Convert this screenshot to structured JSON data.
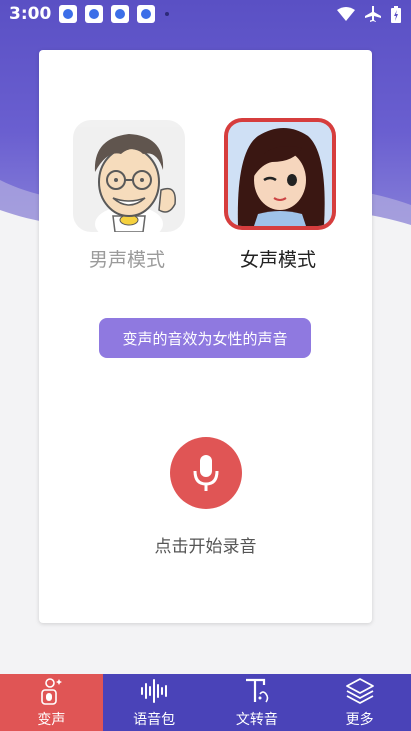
{
  "status_bar": {
    "time": "3:00",
    "app_icons": [
      "baidu-icon",
      "baidu-icon",
      "baidu-icon",
      "baidu-icon"
    ],
    "right_icons": [
      "wifi-icon",
      "airplane-icon",
      "battery-icon"
    ]
  },
  "card": {
    "male_label": "男声模式",
    "female_label": "女声模式",
    "hint": "变声的音效为女性的声音",
    "record_label": "点击开始录音"
  },
  "bottom_nav": {
    "items": [
      {
        "label": "变声",
        "icon": "voice-change-icon"
      },
      {
        "label": "语音包",
        "icon": "waveform-icon"
      },
      {
        "label": "文转音",
        "icon": "text-to-speech-icon"
      },
      {
        "label": "更多",
        "icon": "layers-icon"
      }
    ]
  },
  "colors": {
    "header": "#5a50c4",
    "accent_red": "#e05555",
    "pill": "#8f79e0",
    "nav": "#4a43b8"
  }
}
